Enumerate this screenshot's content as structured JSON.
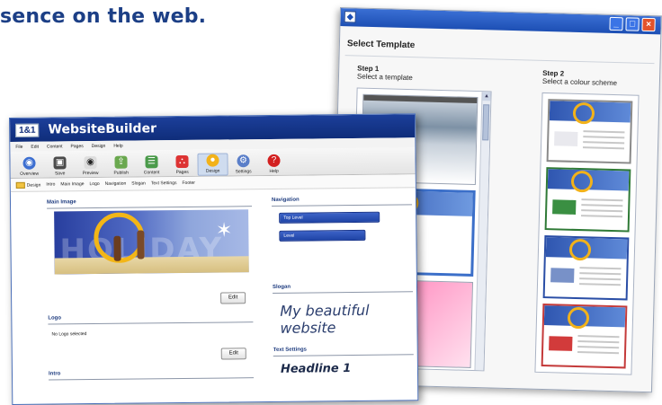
{
  "headline": "sence on the web.",
  "template_window": {
    "title": "Select Template",
    "step1": {
      "label": "Step 1",
      "desc": "Select a template"
    },
    "step2": {
      "label": "Step 2",
      "desc": "Select a colour scheme"
    },
    "buttons": {
      "minimize": "_",
      "maximize": "□",
      "close": "×"
    },
    "scheme_colors": [
      "#8a8a8a",
      "#2f7a36",
      "#2a4ea6",
      "#c43a3a"
    ]
  },
  "builder": {
    "logo": "1&1",
    "title": "WebsiteBuilder",
    "menu": [
      "File",
      "Edit",
      "Content",
      "Pages",
      "Design",
      "Help"
    ],
    "toolbar": [
      {
        "label": "Overview",
        "icon": "globe-icon"
      },
      {
        "label": "Save",
        "icon": "save-icon"
      },
      {
        "label": "Preview",
        "icon": "eye-icon"
      },
      {
        "label": "Publish",
        "icon": "publish-icon"
      },
      {
        "label": "Content",
        "icon": "content-icon"
      },
      {
        "label": "Pages",
        "icon": "pages-icon"
      },
      {
        "label": "Design",
        "icon": "design-icon"
      },
      {
        "label": "Settings",
        "icon": "settings-icon"
      },
      {
        "label": "Help",
        "icon": "help-icon"
      }
    ],
    "tabs": [
      "Design",
      "Intro",
      "Main Image",
      "Logo",
      "Navigation",
      "Slogan",
      "Text Settings",
      "Footer"
    ],
    "sections": {
      "main_image": "Main Image",
      "logo": "Logo",
      "logo_status": "No Logo selected",
      "intro": "Intro",
      "navigation": "Navigation",
      "nav_items": [
        "Top Level",
        "Level"
      ],
      "slogan_title": "Slogan",
      "slogan_text": "My beautiful website",
      "text_settings": "Text Settings",
      "headline": "Headline 1"
    },
    "edit_label": "Edit",
    "main_image_text": "HOLIDAY"
  }
}
